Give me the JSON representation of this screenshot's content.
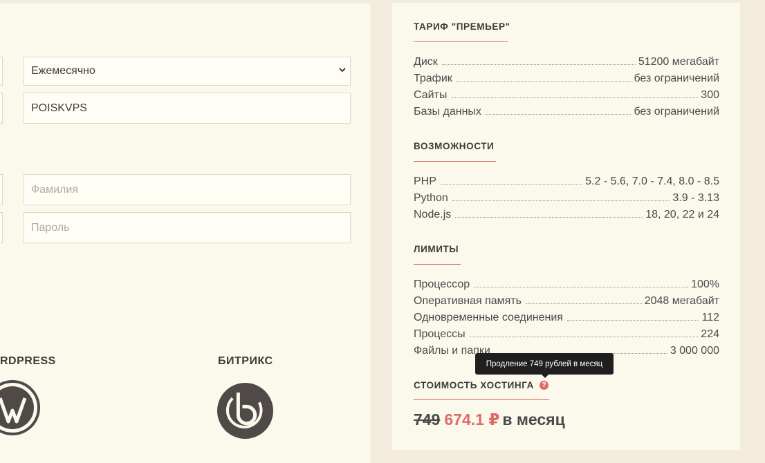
{
  "form": {
    "period_value": "Ежемесячно",
    "promo_value": "POISKVPS",
    "lastname_placeholder": "Фамилия",
    "password_placeholder": "Пароль"
  },
  "cms": {
    "wordpress_title": "RDPRESS",
    "bitrix_title": "БИТРИКС"
  },
  "tariff": {
    "title": "ТАРИФ \"ПРЕМЬЕР\"",
    "rows": [
      {
        "label": "Диск",
        "value": "51200 мегабайт"
      },
      {
        "label": "Трафик",
        "value": "без ограничений"
      },
      {
        "label": "Сайты",
        "value": "300"
      },
      {
        "label": "Базы данных",
        "value": "без ограничений"
      }
    ]
  },
  "features": {
    "title": "ВОЗМОЖНОСТИ",
    "rows": [
      {
        "label": "PHP",
        "value": "5.2 - 5.6, 7.0 - 7.4, 8.0 - 8.5"
      },
      {
        "label": "Python",
        "value": "3.9 - 3.13"
      },
      {
        "label": "Node.js",
        "value": "18, 20, 22 и 24"
      }
    ]
  },
  "limits": {
    "title": "ЛИМИТЫ",
    "rows": [
      {
        "label": "Процессор",
        "value": "100%"
      },
      {
        "label": "Оперативная память",
        "value": "2048 мегабайт"
      },
      {
        "label": "Одновременные соединения",
        "value": "112"
      },
      {
        "label": "Процессы",
        "value": "224"
      },
      {
        "label": "Файлы и папки",
        "value": "3 000 000"
      }
    ]
  },
  "cost": {
    "title": "СТОИМОСТЬ ХОСТИНГА",
    "tooltip": "Продление 749 рублей в месяц",
    "help_icon": "question-circle-icon",
    "old_price": "749",
    "new_price": "674.1 ₽",
    "suffix": "в месяц"
  },
  "colors": {
    "accent": "#e06a64",
    "panel": "#fbf8ec",
    "page": "#f3ecdc"
  }
}
